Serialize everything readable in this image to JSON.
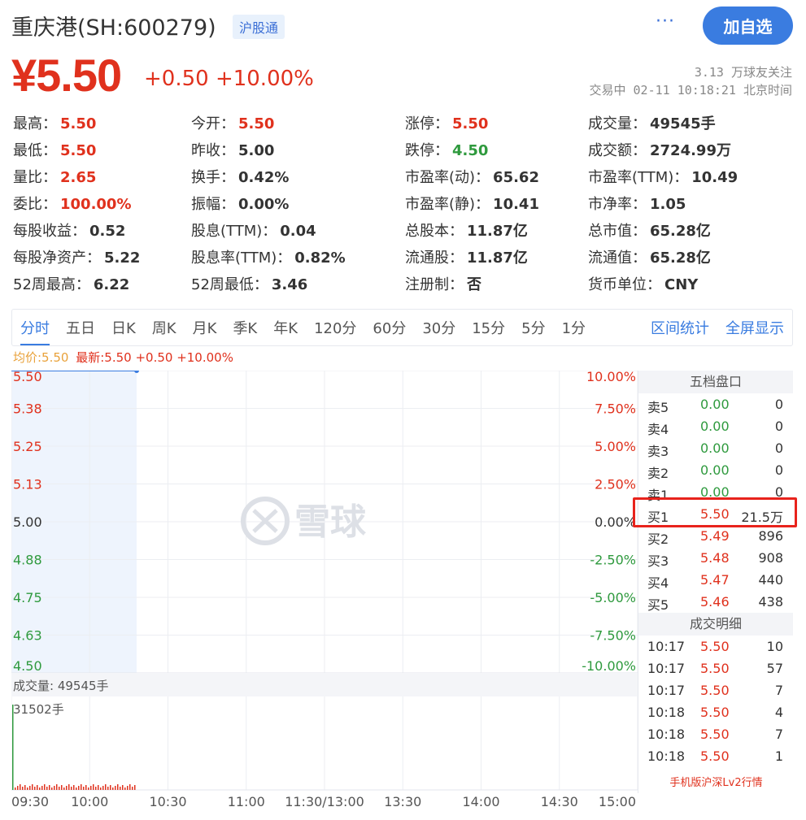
{
  "header": {
    "stock_name": "重庆港(SH:600279)",
    "badge": "沪股通",
    "more_icon": "···",
    "add_button": "加自选"
  },
  "price": {
    "current": "¥5.50",
    "change": "+0.50 +10.00%",
    "followers": "3.13 万球友关注",
    "status_time": "交易中 02-11 10:18:21 北京时间"
  },
  "stats": [
    [
      {
        "label": "最高：",
        "value": "5.50",
        "color": "up"
      },
      {
        "label": "今开：",
        "value": "5.50",
        "color": "up"
      },
      {
        "label": "涨停：",
        "value": "5.50",
        "color": "up"
      },
      {
        "label": "成交量：",
        "value": "49545手",
        "color": ""
      }
    ],
    [
      {
        "label": "最低：",
        "value": "5.50",
        "color": "up"
      },
      {
        "label": "昨收：",
        "value": "5.00",
        "color": ""
      },
      {
        "label": "跌停：",
        "value": "4.50",
        "color": "down"
      },
      {
        "label": "成交额：",
        "value": "2724.99万",
        "color": ""
      }
    ],
    [
      {
        "label": "量比：",
        "value": "2.65",
        "color": "up"
      },
      {
        "label": "换手：",
        "value": "0.42%",
        "color": ""
      },
      {
        "label": "市盈率(动)：",
        "value": "65.62",
        "color": ""
      },
      {
        "label": "市盈率(TTM)：",
        "value": "10.49",
        "color": ""
      }
    ],
    [
      {
        "label": "委比：",
        "value": "100.00%",
        "color": "up"
      },
      {
        "label": "振幅：",
        "value": "0.00%",
        "color": ""
      },
      {
        "label": "市盈率(静)：",
        "value": "10.41",
        "color": ""
      },
      {
        "label": "市净率：",
        "value": "1.05",
        "color": ""
      }
    ],
    [
      {
        "label": "每股收益：",
        "value": "0.52",
        "color": ""
      },
      {
        "label": "股息(TTM)：",
        "value": "0.04",
        "color": ""
      },
      {
        "label": "总股本：",
        "value": "11.87亿",
        "color": ""
      },
      {
        "label": "总市值：",
        "value": "65.28亿",
        "color": ""
      }
    ],
    [
      {
        "label": "每股净资产：",
        "value": "5.22",
        "color": ""
      },
      {
        "label": "股息率(TTM)：",
        "value": "0.82%",
        "color": ""
      },
      {
        "label": "流通股：",
        "value": "11.87亿",
        "color": ""
      },
      {
        "label": "流通值：",
        "value": "65.28亿",
        "color": ""
      }
    ],
    [
      {
        "label": "52周最高：",
        "value": "6.22",
        "color": ""
      },
      {
        "label": "52周最低：",
        "value": "3.46",
        "color": ""
      },
      {
        "label": "注册制：",
        "value": "否",
        "color": ""
      },
      {
        "label": "货币单位：",
        "value": "CNY",
        "color": ""
      }
    ]
  ],
  "tabs": [
    "分时",
    "五日",
    "日K",
    "周K",
    "月K",
    "季K",
    "年K",
    "120分",
    "60分",
    "30分",
    "15分",
    "5分",
    "1分"
  ],
  "tabs_right": [
    "区间统计",
    "全屏显示"
  ],
  "legend": {
    "avg": "均价:5.50",
    "latest": "最新:5.50 +0.50 +10.00%"
  },
  "watermark": "雪球",
  "volume_label": "成交量: 49545手",
  "volume_max_label": "31502手",
  "order_book": {
    "title": "五档盘口",
    "sell": [
      {
        "label": "卖5",
        "price": "0.00",
        "vol": "0"
      },
      {
        "label": "卖4",
        "price": "0.00",
        "vol": "0"
      },
      {
        "label": "卖3",
        "price": "0.00",
        "vol": "0"
      },
      {
        "label": "卖2",
        "price": "0.00",
        "vol": "0"
      },
      {
        "label": "卖1",
        "price": "0.00",
        "vol": "0"
      }
    ],
    "buy": [
      {
        "label": "买1",
        "price": "5.50",
        "vol": "21.5万"
      },
      {
        "label": "买2",
        "price": "5.49",
        "vol": "896"
      },
      {
        "label": "买3",
        "price": "5.48",
        "vol": "908"
      },
      {
        "label": "买4",
        "price": "5.47",
        "vol": "440"
      },
      {
        "label": "买5",
        "price": "5.46",
        "vol": "438"
      }
    ],
    "trades_title": "成交明细",
    "trades": [
      {
        "time": "10:17",
        "price": "5.50",
        "vol": "10"
      },
      {
        "time": "10:17",
        "price": "5.50",
        "vol": "57"
      },
      {
        "time": "10:17",
        "price": "5.50",
        "vol": "7"
      },
      {
        "time": "10:18",
        "price": "5.50",
        "vol": "4"
      },
      {
        "time": "10:18",
        "price": "5.50",
        "vol": "7"
      },
      {
        "time": "10:18",
        "price": "5.50",
        "vol": "1"
      }
    ],
    "mobile_link": "手机版沪深Lv2行情"
  },
  "chart_data": {
    "type": "line",
    "title": "",
    "x_ticks": [
      "09:30",
      "10:00",
      "10:30",
      "11:00",
      "11:30/13:00",
      "13:30",
      "14:00",
      "14:30",
      "15:00"
    ],
    "y_ticks": [
      "5.50",
      "5.38",
      "5.25",
      "5.13",
      "5.00",
      "4.88",
      "4.75",
      "4.63",
      "4.50"
    ],
    "y_values": [
      5.5,
      5.375,
      5.25,
      5.125,
      5.0,
      4.875,
      4.75,
      4.625,
      4.5
    ],
    "pct_ticks": [
      "10.00%",
      "7.50%",
      "5.00%",
      "2.50%",
      "0.00%",
      "-2.50%",
      "-5.00%",
      "-7.50%",
      "-10.00%"
    ],
    "ylim": [
      4.5,
      5.5
    ],
    "prev_close": 5.0,
    "series": [
      {
        "name": "最新",
        "time": [
          "09:30",
          "10:18"
        ],
        "values": [
          5.5,
          5.5
        ]
      }
    ],
    "volume": {
      "max": 31502,
      "first_bar": 31502
    }
  },
  "colors": {
    "up": "#e0311d",
    "down": "#2f9a3e",
    "accent": "#3a7ce0",
    "avg": "#e9a23b"
  }
}
